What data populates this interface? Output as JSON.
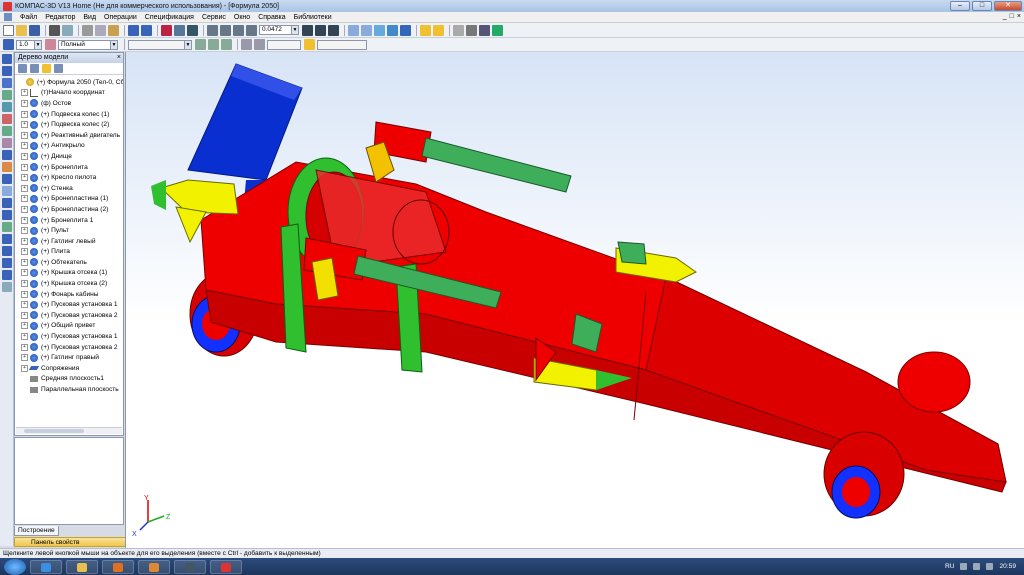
{
  "window": {
    "title": "КОМПАС-3D V13 Home (Не для коммерческого использования) - [Формула 2050]"
  },
  "menu": [
    "Файл",
    "Редактор",
    "Вид",
    "Операции",
    "Спецификация",
    "Сервис",
    "Окно",
    "Справка",
    "Библиотеки"
  ],
  "toolbar": {
    "zoom_value": "0.0472",
    "step_value": "1.0",
    "view_mode": "Полный"
  },
  "tree_panel": {
    "title": "Дерево модели",
    "items": [
      {
        "label": "(+) Формула 2050 (Тел-0, Сбо",
        "icon": "assembly-icon",
        "expandable": false,
        "root": true
      },
      {
        "label": "(т)Начало координат",
        "icon": "origin-icon",
        "expandable": true
      },
      {
        "label": "(ф) Остов",
        "icon": "part-icon",
        "expandable": true
      },
      {
        "label": "(+) Подвеска колес (1)",
        "icon": "part-icon",
        "expandable": true
      },
      {
        "label": "(+) Подвеска колес (2)",
        "icon": "part-icon",
        "expandable": true
      },
      {
        "label": "(+) Реактивный двигатель",
        "icon": "part-icon",
        "expandable": true
      },
      {
        "label": "(+) Антикрыло",
        "icon": "part-icon",
        "expandable": true
      },
      {
        "label": "(+) Днище",
        "icon": "part-icon",
        "expandable": true
      },
      {
        "label": "(+) Бронеплита",
        "icon": "part-icon",
        "expandable": true
      },
      {
        "label": "(+) Кресло пилота",
        "icon": "part-icon",
        "expandable": true
      },
      {
        "label": "(+) Стенка",
        "icon": "part-icon",
        "expandable": true
      },
      {
        "label": "(+) Бронепластина (1)",
        "icon": "part-icon",
        "expandable": true
      },
      {
        "label": "(+) Бронепластина (2)",
        "icon": "part-icon",
        "expandable": true
      },
      {
        "label": "(+) Бронеплита 1",
        "icon": "part-icon",
        "expandable": true
      },
      {
        "label": "(+) Пульт",
        "icon": "part-icon",
        "expandable": true
      },
      {
        "label": "(+) Гатлинг левый",
        "icon": "part-icon",
        "expandable": true
      },
      {
        "label": "(+) Плита",
        "icon": "part-icon",
        "expandable": true
      },
      {
        "label": "(+) Обтекатель",
        "icon": "part-icon",
        "expandable": true
      },
      {
        "label": "(+) Крышка отсека (1)",
        "icon": "part-icon",
        "expandable": true
      },
      {
        "label": "(+) Крышка отсека (2)",
        "icon": "part-icon",
        "expandable": true
      },
      {
        "label": "(+) Фонарь кабины",
        "icon": "part-icon",
        "expandable": true
      },
      {
        "label": "(+) Пусковая установка 1",
        "icon": "part-icon",
        "expandable": true
      },
      {
        "label": "(+) Пусковая установка 2",
        "icon": "part-icon",
        "expandable": true
      },
      {
        "label": "(+) Общий привет",
        "icon": "part-icon",
        "expandable": true
      },
      {
        "label": "(+) Пусковая установка 1",
        "icon": "part-icon",
        "expandable": true
      },
      {
        "label": "(+) Пусковая установка 2",
        "icon": "part-icon",
        "expandable": true
      },
      {
        "label": "(+) Гатлинг правый",
        "icon": "part-icon",
        "expandable": true
      },
      {
        "label": "Сопряжения",
        "icon": "mates-icon",
        "expandable": true
      },
      {
        "label": "Средняя плоскость1",
        "icon": "plane-icon",
        "expandable": false
      },
      {
        "label": "Параллельная плоскость",
        "icon": "plane-icon",
        "expandable": false
      }
    ]
  },
  "bottom_tabs": {
    "build_tab": "Построение",
    "properties_bar": "Панель свойств"
  },
  "status": "Щелкните левой кнопкой мыши на объекте для его выделения (вместе с Ctrl - добавить к выделенным)",
  "axes": {
    "x": "X",
    "y": "Y",
    "z": "Z"
  },
  "tray": {
    "language": "RU",
    "time": "20:59"
  },
  "colors": {
    "body": "#ee0000",
    "stripe": "#2fbf2f",
    "wing": "#0a2fd0",
    "rocket": "#f2f200",
    "barrel": "#3fae5a",
    "wheel": "#1230ff"
  }
}
